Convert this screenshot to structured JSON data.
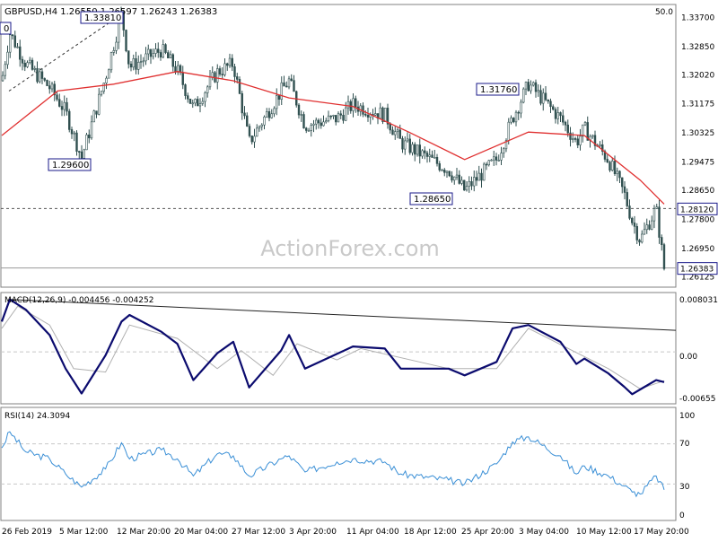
{
  "main": {
    "header": "GBPUSD,H4  1.26550 1.26597 1.26243 1.26383",
    "ema_label": "50.0",
    "watermark": "ActionForex.com",
    "y_ticks": [
      "1.33700",
      "1.32850",
      "1.32020",
      "1.31175",
      "1.30325",
      "1.29475",
      "1.28650",
      "1.27800",
      "1.26950",
      "1.26125"
    ],
    "annotations": [
      {
        "text": "1.33810",
        "value": 1.3381
      },
      {
        "text": "1.29600",
        "value": 1.296
      },
      {
        "text": "1.31760",
        "value": 1.3176
      },
      {
        "text": "1.28650",
        "value": 1.2865
      }
    ],
    "reference_line": {
      "text": "1.28120",
      "value": 1.2812
    },
    "current_price": {
      "text": "1.26383",
      "value": 1.26383
    },
    "left_edge_label": "0"
  },
  "macd": {
    "header": "MACD(12,26,9) -0.004456 -0.004252",
    "y_ticks": [
      "0.008031",
      "0.00",
      "-0.00655"
    ]
  },
  "rsi": {
    "header": "RSI(14) 24.3094",
    "y_ticks": [
      "100",
      "70",
      "30",
      "0"
    ]
  },
  "x_labels": [
    "26 Feb 2019",
    "5 Mar 12:00",
    "12 Mar 20:00",
    "20 Mar 04:00",
    "27 Mar 12:00",
    "3 Apr 20:00",
    "11 Apr 04:00",
    "18 Apr 12:00",
    "25 Apr 20:00",
    "3 May 04:00",
    "10 May 12:00",
    "17 May 20:00"
  ],
  "colors": {
    "candle": "#2f4f4f",
    "ema": "#e03030",
    "macd_main": "#0b0b6e",
    "macd_signal": "#b0b0b0",
    "rsi": "#3a8fd6",
    "grid": "#c8c8c8",
    "frame": "#808080",
    "label_border": "#1a1a8a"
  },
  "chart_data": [
    {
      "type": "candlestick",
      "title": "GBPUSD,H4",
      "ylim": [
        1.2585,
        1.3405
      ],
      "pivots": [
        {
          "x": "26 Feb 2019",
          "y": 1.3185
        },
        {
          "x": "27 Feb 2019",
          "y": 1.3325
        },
        {
          "x": "1 Mar 2019",
          "y": 1.3235
        },
        {
          "x": "4 Mar 2019",
          "y": 1.3165
        },
        {
          "x": "6 Mar 2019",
          "y": 1.3095
        },
        {
          "x": "8 Mar 2019",
          "y": 1.296
        },
        {
          "x": "11 Mar 2019",
          "y": 1.3195
        },
        {
          "x": "13 Mar 2019",
          "y": 1.3381
        },
        {
          "x": "14 Mar 2019",
          "y": 1.3225
        },
        {
          "x": "18 Mar 2019",
          "y": 1.3275
        },
        {
          "x": "20 Mar 2019",
          "y": 1.3215
        },
        {
          "x": "22 Mar 2019",
          "y": 1.3105
        },
        {
          "x": "25 Mar 2019",
          "y": 1.321
        },
        {
          "x": "27 Mar 2019",
          "y": 1.3235
        },
        {
          "x": "29 Mar 2019",
          "y": 1.3005
        },
        {
          "x": "2 Apr 2019",
          "y": 1.3155
        },
        {
          "x": "3 Apr 2019",
          "y": 1.3185
        },
        {
          "x": "5 Apr 2019",
          "y": 1.3055
        },
        {
          "x": "9 Apr 2019",
          "y": 1.3075
        },
        {
          "x": "11 Apr 2019",
          "y": 1.3115
        },
        {
          "x": "15 Apr 2019",
          "y": 1.3085
        },
        {
          "x": "17 Apr 2019",
          "y": 1.3005
        },
        {
          "x": "23 Apr 2019",
          "y": 1.2925
        },
        {
          "x": "25 Apr 2019",
          "y": 1.2865
        },
        {
          "x": "29 Apr 2019",
          "y": 1.2955
        },
        {
          "x": "1 May 2019",
          "y": 1.3075
        },
        {
          "x": "3 May 2019",
          "y": 1.3176
        },
        {
          "x": "7 May 2019",
          "y": 1.3075
        },
        {
          "x": "9 May 2019",
          "y": 1.3005
        },
        {
          "x": "10 May 2019",
          "y": 1.3045
        },
        {
          "x": "13 May 2019",
          "y": 1.2955
        },
        {
          "x": "15 May 2019",
          "y": 1.2855
        },
        {
          "x": "16 May 2019",
          "y": 1.2775
        },
        {
          "x": "17 May 2019",
          "y": 1.272
        },
        {
          "x": "19 May 2019",
          "y": 1.2812
        },
        {
          "x": "20 May 2019",
          "y": 1.2638
        }
      ],
      "ema50": [
        {
          "x": "26 Feb 2019",
          "y": 1.3025
        },
        {
          "x": "5 Mar 2019",
          "y": 1.3155
        },
        {
          "x": "12 Mar 2019",
          "y": 1.3175
        },
        {
          "x": "20 Mar 2019",
          "y": 1.3212
        },
        {
          "x": "27 Mar 2019",
          "y": 1.3185
        },
        {
          "x": "3 Apr 2019",
          "y": 1.3135
        },
        {
          "x": "11 Apr 2019",
          "y": 1.311
        },
        {
          "x": "18 Apr 2019",
          "y": 1.3035
        },
        {
          "x": "25 Apr 2019",
          "y": 1.2955
        },
        {
          "x": "3 May 2019",
          "y": 1.3035
        },
        {
          "x": "10 May 2019",
          "y": 1.3025
        },
        {
          "x": "17 May 2019",
          "y": 1.2895
        },
        {
          "x": "20 May 2019",
          "y": 1.2825
        }
      ],
      "levels": [
        1.2812,
        1.26383
      ]
    },
    {
      "type": "line",
      "title": "MACD(12,26,9)",
      "ylim": [
        -0.0076,
        0.0087
      ],
      "series": [
        {
          "name": "MACD",
          "points": [
            {
              "x": "26 Feb 2019",
              "y": 0.0045
            },
            {
              "x": "27 Feb 2019",
              "y": 0.0078
            },
            {
              "x": "1 Mar 2019",
              "y": 0.0063
            },
            {
              "x": "4 Mar 2019",
              "y": 0.0025
            },
            {
              "x": "6 Mar 2019",
              "y": -0.0025
            },
            {
              "x": "8 Mar 2019",
              "y": -0.0062
            },
            {
              "x": "11 Mar 2019",
              "y": -0.0005
            },
            {
              "x": "13 Mar 2019",
              "y": 0.0045
            },
            {
              "x": "14 Mar 2019",
              "y": 0.0055
            },
            {
              "x": "18 Mar 2019",
              "y": 0.003
            },
            {
              "x": "20 Mar 2019",
              "y": 0.0012
            },
            {
              "x": "22 Mar 2019",
              "y": -0.0042
            },
            {
              "x": "25 Mar 2019",
              "y": -0.0002
            },
            {
              "x": "27 Mar 2019",
              "y": 0.0015
            },
            {
              "x": "29 Mar 2019",
              "y": -0.0053
            },
            {
              "x": "2 Apr 2019",
              "y": 0.0002
            },
            {
              "x": "3 Apr 2019",
              "y": 0.0025
            },
            {
              "x": "5 Apr 2019",
              "y": -0.0025
            },
            {
              "x": "9 Apr 2019",
              "y": -0.0003
            },
            {
              "x": "11 Apr 2019",
              "y": 0.0008
            },
            {
              "x": "15 Apr 2019",
              "y": 0.0005
            },
            {
              "x": "17 Apr 2019",
              "y": -0.0025
            },
            {
              "x": "23 Apr 2019",
              "y": -0.0025
            },
            {
              "x": "25 Apr 2019",
              "y": -0.0035
            },
            {
              "x": "29 Apr 2019",
              "y": -0.0015
            },
            {
              "x": "1 May 2019",
              "y": 0.0035
            },
            {
              "x": "3 May 2019",
              "y": 0.004
            },
            {
              "x": "7 May 2019",
              "y": 0.0015
            },
            {
              "x": "9 May 2019",
              "y": -0.0018
            },
            {
              "x": "10 May 2019",
              "y": -0.001
            },
            {
              "x": "13 May 2019",
              "y": -0.0032
            },
            {
              "x": "15 May 2019",
              "y": -0.0052
            },
            {
              "x": "16 May 2019",
              "y": -0.0063
            },
            {
              "x": "17 May 2019",
              "y": -0.0056
            },
            {
              "x": "19 May 2019",
              "y": -0.0042
            },
            {
              "x": "20 May 2019",
              "y": -0.0045
            }
          ]
        },
        {
          "name": "Signal",
          "points": [
            {
              "x": "26 Feb 2019",
              "y": 0.0035
            },
            {
              "x": "28 Feb 2019",
              "y": 0.0068
            },
            {
              "x": "4 Mar 2019",
              "y": 0.004
            },
            {
              "x": "7 Mar 2019",
              "y": -0.0025
            },
            {
              "x": "11 Mar 2019",
              "y": -0.003
            },
            {
              "x": "14 Mar 2019",
              "y": 0.004
            },
            {
              "x": "20 Mar 2019",
              "y": 0.002
            },
            {
              "x": "25 Mar 2019",
              "y": -0.0025
            },
            {
              "x": "28 Mar 2019",
              "y": 0.0002
            },
            {
              "x": "1 Apr 2019",
              "y": -0.0035
            },
            {
              "x": "4 Apr 2019",
              "y": 0.0012
            },
            {
              "x": "9 Apr 2019",
              "y": -0.0012
            },
            {
              "x": "12 Apr 2019",
              "y": 0.0005
            },
            {
              "x": "23 Apr 2019",
              "y": -0.0025
            },
            {
              "x": "29 Apr 2019",
              "y": -0.0025
            },
            {
              "x": "3 May 2019",
              "y": 0.0035
            },
            {
              "x": "8 May 2019",
              "y": 0.0005
            },
            {
              "x": "13 May 2019",
              "y": -0.0025
            },
            {
              "x": "17 May 2019",
              "y": -0.0055
            },
            {
              "x": "20 May 2019",
              "y": -0.0043
            }
          ]
        }
      ],
      "trendline": [
        {
          "x": "27 Feb 2019",
          "y": 0.0078
        },
        {
          "x": "20 May 2019",
          "y": 0.0032
        }
      ]
    },
    {
      "type": "line",
      "title": "RSI(14)",
      "ylim": [
        0,
        100
      ],
      "levels": [
        70,
        30
      ],
      "series": [
        {
          "name": "RSI",
          "points": [
            {
              "x": "26 Feb 2019",
              "y": 66
            },
            {
              "x": "27 Feb 2019",
              "y": 82
            },
            {
              "x": "1 Mar 2019",
              "y": 62
            },
            {
              "x": "4 Mar 2019",
              "y": 55
            },
            {
              "x": "6 Mar 2019",
              "y": 40
            },
            {
              "x": "8 Mar 2019",
              "y": 27
            },
            {
              "x": "11 Mar 2019",
              "y": 45
            },
            {
              "x": "13 Mar 2019",
              "y": 71
            },
            {
              "x": "14 Mar 2019",
              "y": 55
            },
            {
              "x": "18 Mar 2019",
              "y": 64
            },
            {
              "x": "20 Mar 2019",
              "y": 55
            },
            {
              "x": "22 Mar 2019",
              "y": 38
            },
            {
              "x": "25 Mar 2019",
              "y": 60
            },
            {
              "x": "27 Mar 2019",
              "y": 58
            },
            {
              "x": "29 Mar 2019",
              "y": 38
            },
            {
              "x": "2 Apr 2019",
              "y": 55
            },
            {
              "x": "3 Apr 2019",
              "y": 58
            },
            {
              "x": "5 Apr 2019",
              "y": 42
            },
            {
              "x": "9 Apr 2019",
              "y": 52
            },
            {
              "x": "11 Apr 2019",
              "y": 55
            },
            {
              "x": "15 Apr 2019",
              "y": 52
            },
            {
              "x": "17 Apr 2019",
              "y": 40
            },
            {
              "x": "23 Apr 2019",
              "y": 34
            },
            {
              "x": "25 Apr 2019",
              "y": 30
            },
            {
              "x": "29 Apr 2019",
              "y": 50
            },
            {
              "x": "1 May 2019",
              "y": 72
            },
            {
              "x": "3 May 2019",
              "y": 77
            },
            {
              "x": "7 May 2019",
              "y": 58
            },
            {
              "x": "9 May 2019",
              "y": 40
            },
            {
              "x": "10 May 2019",
              "y": 48
            },
            {
              "x": "13 May 2019",
              "y": 38
            },
            {
              "x": "15 May 2019",
              "y": 28
            },
            {
              "x": "16 May 2019",
              "y": 22
            },
            {
              "x": "17 May 2019",
              "y": 20
            },
            {
              "x": "19 May 2019",
              "y": 38
            },
            {
              "x": "20 May 2019",
              "y": 24.3
            }
          ]
        }
      ]
    }
  ]
}
